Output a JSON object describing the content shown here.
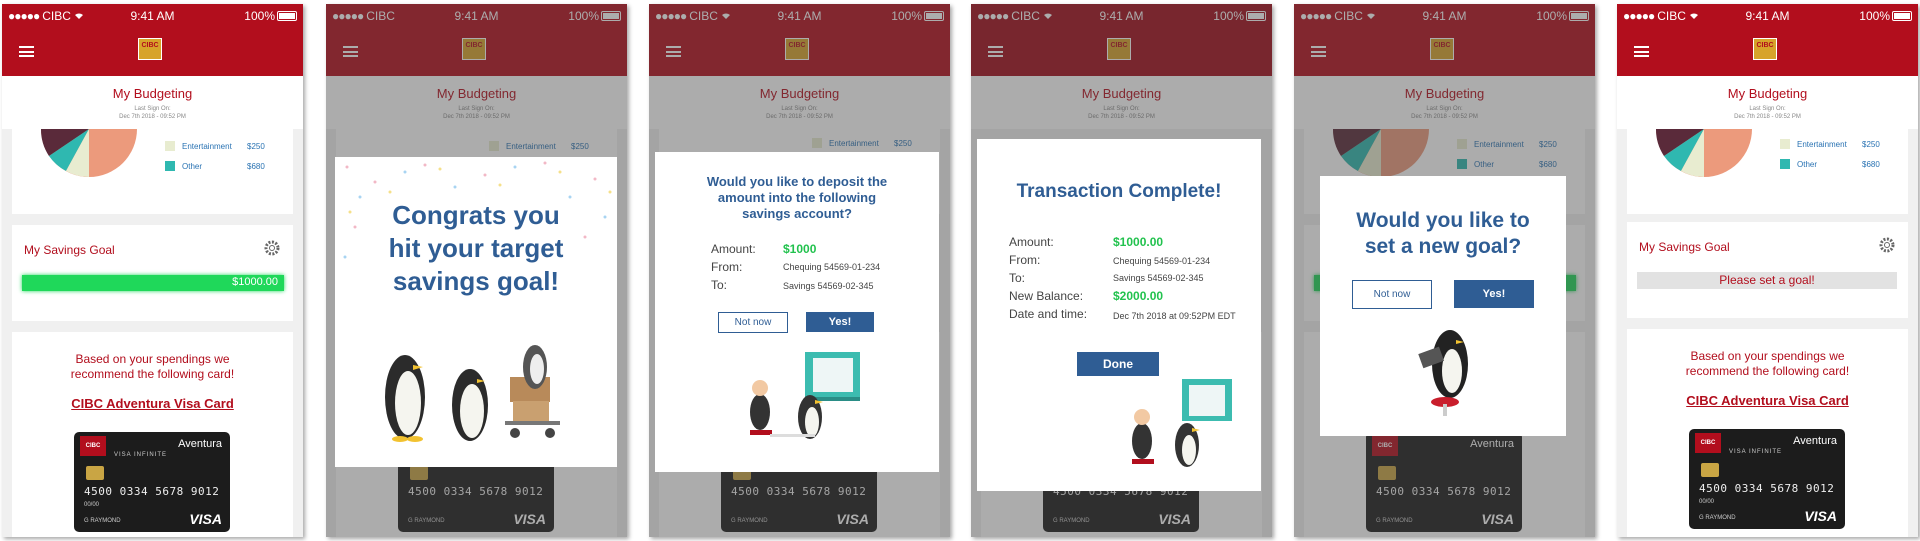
{
  "status": {
    "carrier": "CIBC",
    "time": "9:41 AM",
    "battery": "100%"
  },
  "header": {
    "logo": "CIBC",
    "title": "My Budgeting",
    "last_sign_label": "Last Sign On:",
    "last_sign_value": "Dec 7th 2018 - 09:52 PM"
  },
  "budget": {
    "legend": [
      {
        "label": "Entertainment",
        "value": "$250",
        "color": "#e8ecd0"
      },
      {
        "label": "Other",
        "value": "$680",
        "color": "#2fb8b0"
      }
    ],
    "pie_colors": [
      "#5a2a3a",
      "#e8ecd0",
      "#2fb8b0",
      "#ec9a7c"
    ]
  },
  "savings": {
    "title": "My Savings Goal",
    "amount": "$1000.00",
    "progress": 1.0,
    "empty_goal": "Please set a goal!"
  },
  "recommendation": {
    "text_line1": "Based on your spendings we",
    "text_line2": "recommend the following card!",
    "card_name": "CIBC Adventura Visa Card"
  },
  "visa_card": {
    "brand": "CIBC",
    "name": "Aventura",
    "tier": "VISA INFINITE",
    "number": "4500 0334 5678 9012",
    "expiry": "00/00",
    "holder": "G RAYMOND",
    "network": "VISA"
  },
  "congrats": {
    "line1": "Congrats you",
    "line2": "hit your target",
    "line3": "savings goal!"
  },
  "deposit": {
    "question_line1": "Would you like to deposit the",
    "question_line2": "amount into the following",
    "question_line3": "savings account?",
    "amount_label": "Amount:",
    "amount_value": "$1000",
    "from_label": "From:",
    "from_value": "Chequing 54569-01-234",
    "to_label": "To:",
    "to_value": "Savings 54569-02-345",
    "no_label": "Not now",
    "yes_label": "Yes!"
  },
  "complete": {
    "title": "Transaction Complete!",
    "amount_label": "Amount:",
    "amount_value": "$1000.00",
    "from_label": "From:",
    "from_value": "Chequing 54569-01-234",
    "to_label": "To:",
    "to_value": "Savings 54569-02-345",
    "balance_label": "New Balance:",
    "balance_value": "$2000.00",
    "date_label": "Date and time:",
    "date_value": "Dec 7th 2018 at 09:52PM EDT",
    "done_label": "Done"
  },
  "newgoal": {
    "line1": "Would you like to",
    "line2": "set a new goal?",
    "no_label": "Not now",
    "yes_label": "Yes!"
  }
}
